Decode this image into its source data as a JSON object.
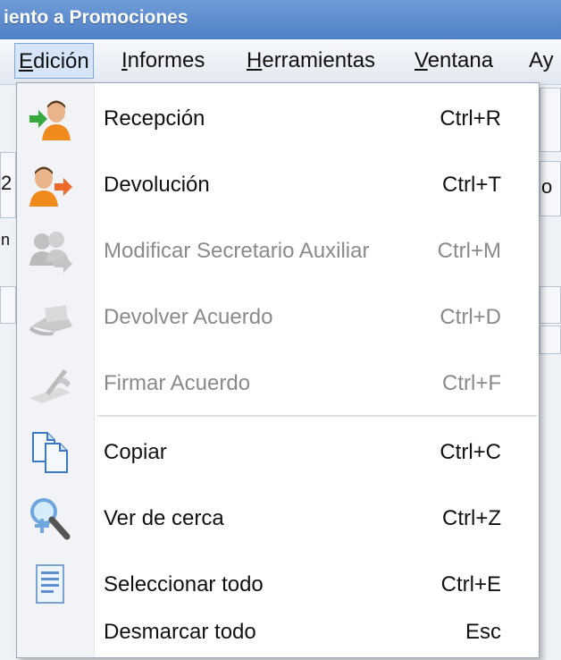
{
  "window": {
    "title": "iento a Promociones"
  },
  "menubar": {
    "items": [
      {
        "key": "E",
        "rest": "dición"
      },
      {
        "key": "I",
        "rest": "nformes"
      },
      {
        "key": "H",
        "rest": "erramientas"
      },
      {
        "key": "V",
        "rest": "entana"
      },
      {
        "key": "",
        "rest": "Ay"
      }
    ]
  },
  "background": {
    "frag1": "2",
    "frag2": "n",
    "frag3": "o"
  },
  "menu": {
    "items": [
      {
        "label": "Recepción",
        "shortcut": "Ctrl+R",
        "enabled": true,
        "icon": "user-receive-icon"
      },
      {
        "label": "Devolución",
        "shortcut": "Ctrl+T",
        "enabled": true,
        "icon": "user-return-icon"
      },
      {
        "label": "Modificar Secretario Auxiliar",
        "shortcut": "Ctrl+M",
        "enabled": false,
        "icon": "users-transfer-icon"
      },
      {
        "label": "Devolver Acuerdo",
        "shortcut": "Ctrl+D",
        "enabled": false,
        "icon": "hand-document-icon"
      },
      {
        "label": "Firmar Acuerdo",
        "shortcut": "Ctrl+F",
        "enabled": false,
        "icon": "sign-pen-icon"
      },
      {
        "label": "Copiar",
        "shortcut": "Ctrl+C",
        "enabled": true,
        "icon": "copy-icon"
      },
      {
        "label": "Ver de cerca",
        "shortcut": "Ctrl+Z",
        "enabled": true,
        "icon": "zoom-icon"
      },
      {
        "label": "Seleccionar todo",
        "shortcut": "Ctrl+E",
        "enabled": true,
        "icon": "select-all-icon"
      },
      {
        "label": "Desmarcar todo",
        "shortcut": "Esc",
        "enabled": true,
        "icon": ""
      }
    ]
  },
  "colors": {
    "titlebar": "#5a8ace",
    "accent_green": "#2e9e3a",
    "accent_orange": "#ee7a2e",
    "menu_hover": "#d6e6f8"
  }
}
